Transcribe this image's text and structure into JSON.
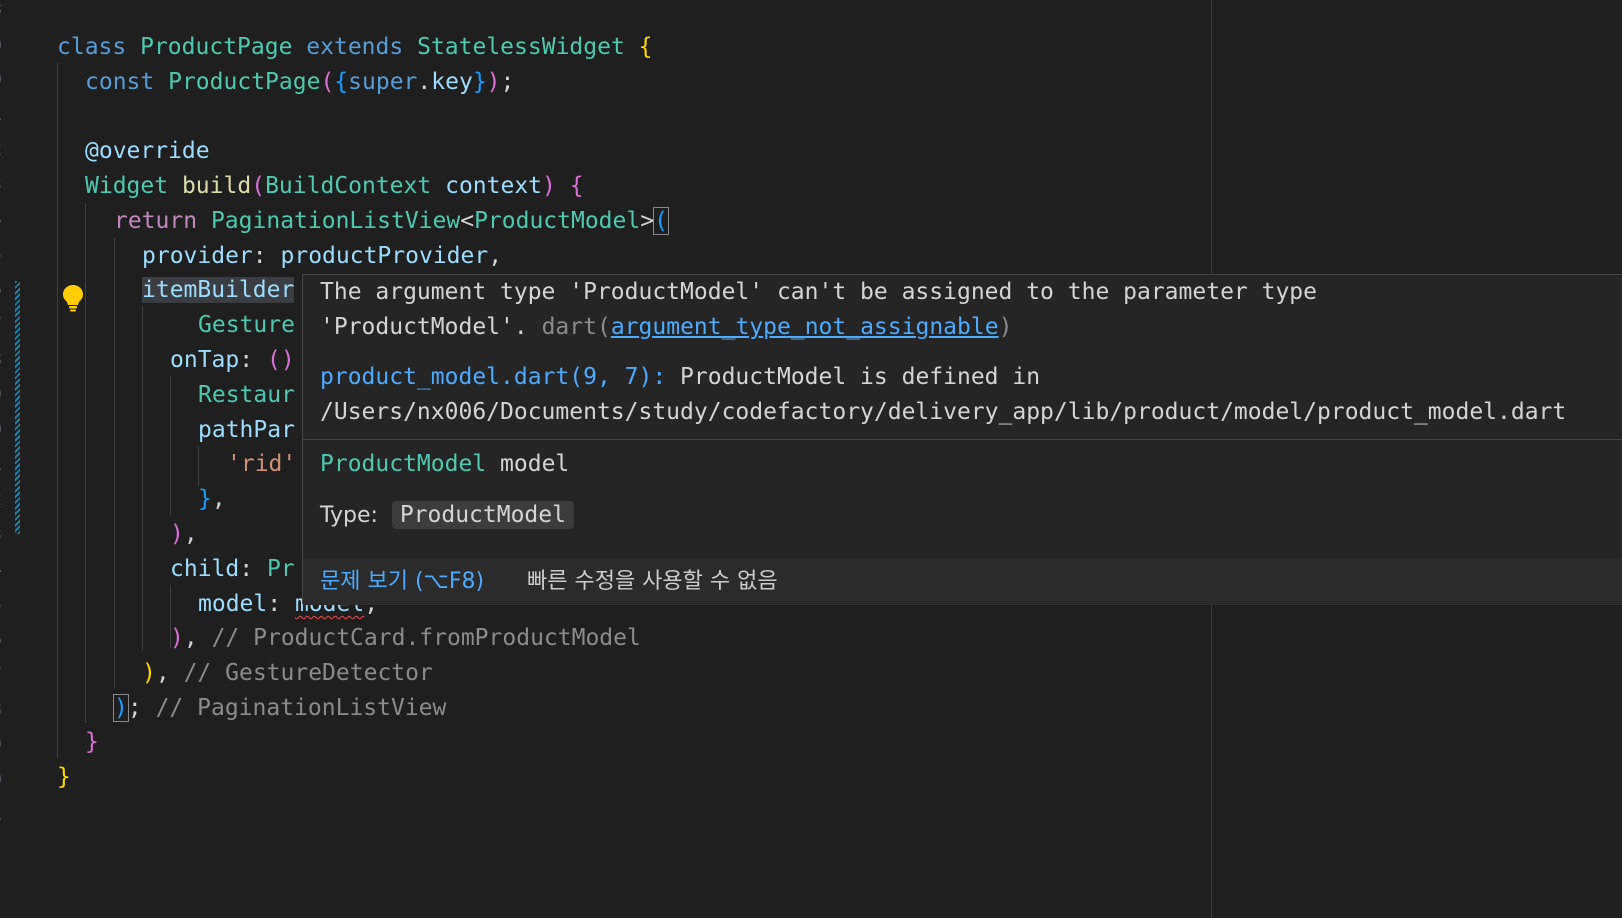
{
  "code": {
    "l1": {
      "kw": "class",
      "cls": "ProductPage",
      "kw2": "extends",
      "cls2": "StatelessWidget",
      "brace": "{"
    },
    "l2": {
      "kw": "const",
      "cls": "ProductPage",
      "p1": "(",
      "b1": "{",
      "kw2": "super",
      "dot": ".",
      "var": "key",
      "b2": "}",
      "p2": ")",
      "semi": ";"
    },
    "l4": {
      "ann": "@override"
    },
    "l5": {
      "cls": "Widget",
      "fn": "build",
      "p1": "(",
      "cls2": "BuildContext",
      "var": "context",
      "p2": ")",
      "brace": "{"
    },
    "l6": {
      "kw": "return",
      "cls": "PaginationListView",
      "lt": "<",
      "cls2": "ProductModel",
      "gt": ">",
      "p": "("
    },
    "l7": {
      "var": "provider",
      "colon": ":",
      "var2": "productProvider",
      "comma": ","
    },
    "l8": {
      "var": "itemBuilder"
    },
    "l9": {
      "cls": "Gesture"
    },
    "l10": {
      "var": "onTap",
      "colon": ":",
      "p": "()"
    },
    "l11": {
      "cls": "Restaur"
    },
    "l12": {
      "var": "pathPar"
    },
    "l13": {
      "str": "'rid'"
    },
    "l14": {
      "b": "}",
      "comma": ","
    },
    "l15": {
      "p": ")",
      "comma": ","
    },
    "l16": {
      "var": "child",
      "colon": ":",
      "cls": "Pr"
    },
    "l17": {
      "var": "model",
      "colon": ":",
      "var2": "model",
      "comma": ","
    },
    "l18": {
      "p": ")",
      "comma": ",",
      "cmt": "// ProductCard.fromProductModel"
    },
    "l19": {
      "p": ")",
      "comma": ",",
      "cmt": "// GestureDetector"
    },
    "l20": {
      "p": ")",
      "semi": ";",
      "cmt": "// PaginationListView"
    },
    "l21": {
      "b": "}"
    },
    "l22": {
      "b": "}"
    }
  },
  "hover": {
    "message_line1": "The argument type 'ProductModel' can't be assigned to the parameter type",
    "message_line2": "'ProductModel'.",
    "source": "dart(",
    "code_link": "argument_type_not_assignable",
    "source_close": ")",
    "related_link": "product_model.dart(9, 7):",
    "related_text": "ProductModel is defined in",
    "related_path": "/Users/nx006/Documents/study/codefactory/delivery_app/lib/product/model/product_model.dart",
    "sig_type": "ProductModel",
    "sig_name": "model",
    "type_label": "Type:",
    "type_value": "ProductModel",
    "view_problem": "문제 보기 (⌥F8)",
    "no_quick_fix": "빠른 수정을 사용할 수 없음"
  },
  "colors": {
    "background": "#1f1f1f",
    "keyword": "#569cd6",
    "control": "#c586c0",
    "class": "#4ec9b0",
    "function": "#dcdcaa",
    "variable": "#9cdcfe",
    "string": "#ce9178",
    "comment": "#8b8b8b",
    "link": "#4daafc",
    "error": "#f14c4c"
  },
  "icons": {
    "lightbulb": "lightbulb-icon"
  }
}
